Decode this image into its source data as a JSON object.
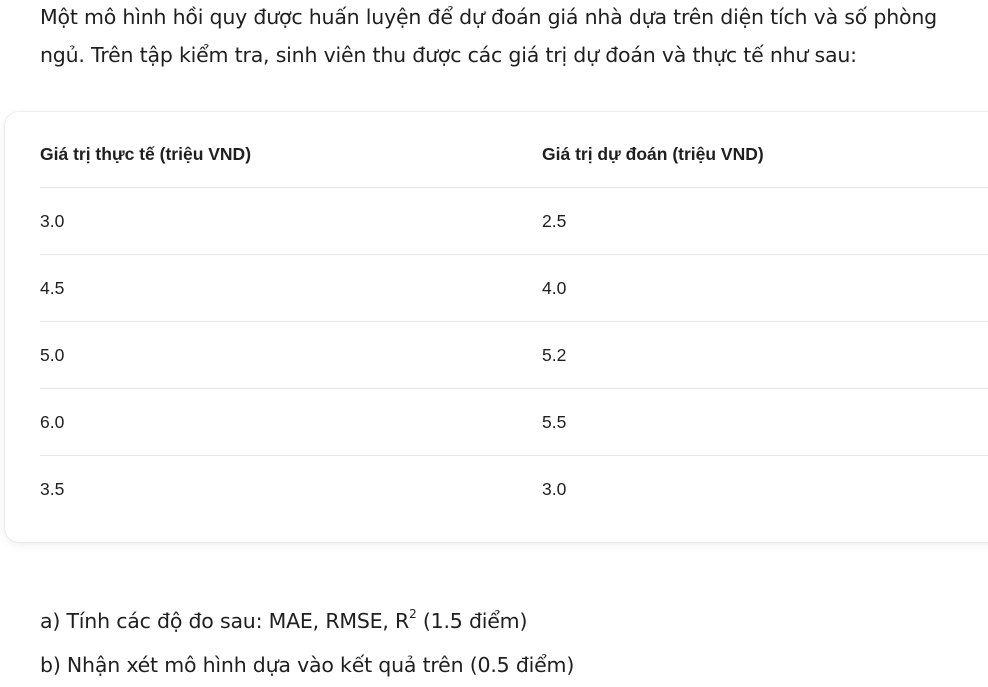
{
  "intro": {
    "line1": "Một mô hình hồi quy được huấn luyện để dự đoán giá nhà dựa trên diện tích và số phòng",
    "line2": "ngủ. Trên tập kiểm tra, sinh viên thu được các giá trị dự đoán và thực tế như sau:"
  },
  "table": {
    "headers": [
      "Giá trị thực tế (triệu VND)",
      "Giá trị dự đoán (triệu VND)"
    ],
    "rows": [
      [
        "3.0",
        "2.5"
      ],
      [
        "4.5",
        "4.0"
      ],
      [
        "5.0",
        "5.2"
      ],
      [
        "6.0",
        "5.5"
      ],
      [
        "3.5",
        "3.0"
      ]
    ]
  },
  "questions": {
    "a_prefix": "a) Tính các độ đo sau: MAE, RMSE, R",
    "a_sup": "2",
    "a_suffix": " (1.5 điểm)",
    "b": "b) Nhận xét mô hình dựa vào kết quả trên (0.5 điểm)"
  }
}
